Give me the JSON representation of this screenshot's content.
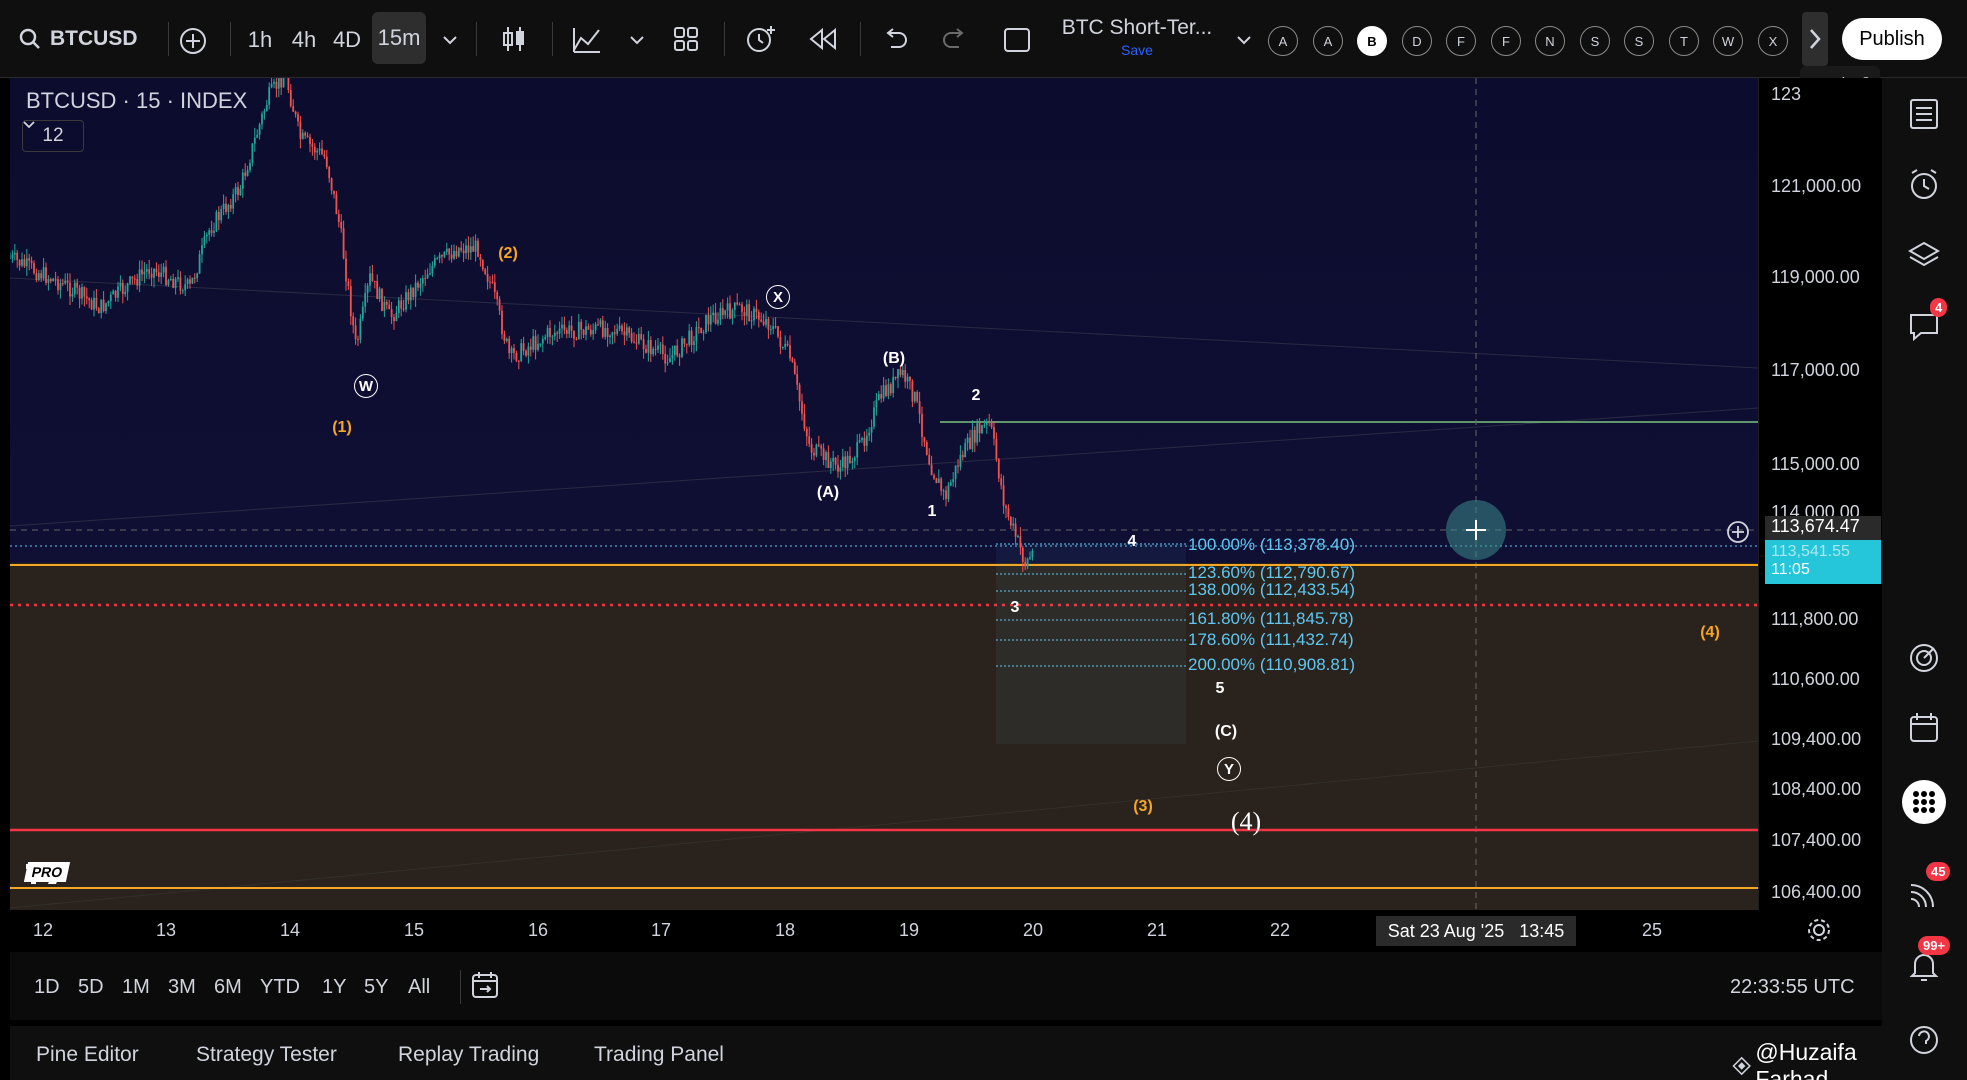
{
  "toolbar": {
    "symbol": "BTCUSD",
    "intervals": [
      "1h",
      "4h",
      "4D",
      "15m"
    ],
    "active_interval": "15m",
    "layout_name": "BTC Short-Ter...",
    "save_label": "Save",
    "letters": [
      "A",
      "A",
      "B",
      "D",
      "F",
      "F",
      "N",
      "S",
      "S",
      "T",
      "W",
      "X"
    ],
    "active_letter": "B",
    "publish_label": "Publish"
  },
  "chart": {
    "legend_title": "BTCUSD · 15 · INDEX",
    "indicator_count": "12",
    "watermark": "PRO",
    "current_price": "113,674.47",
    "countdown": "11:05",
    "last_price_partial": "113,541.55"
  },
  "wave_labels": [
    {
      "text": "W",
      "style": "circle"
    },
    {
      "text": "(1)",
      "style": "orange"
    },
    {
      "text": "(2)",
      "style": "orange"
    },
    {
      "text": "X",
      "style": "circle"
    },
    {
      "text": "(B)",
      "style": "white"
    },
    {
      "text": "(A)",
      "style": "white"
    },
    {
      "text": "2",
      "style": "white"
    },
    {
      "text": "1",
      "style": "white"
    },
    {
      "text": "4",
      "style": "white"
    },
    {
      "text": "3",
      "style": "white"
    },
    {
      "text": "5",
      "style": "white"
    },
    {
      "text": "(C)",
      "style": "white"
    },
    {
      "text": "Y",
      "style": "circle"
    },
    {
      "text": "(3)",
      "style": "orange"
    },
    {
      "text": "(4)",
      "style": "white-large"
    },
    {
      "text": "(4)",
      "style": "orange"
    }
  ],
  "fib_levels": [
    "100.00% (113,378.40)",
    "123.60% (112,790.67)",
    "138.00% (112,433.54)",
    "161.80% (111,845.78)",
    "178.60% (111,432.74)",
    "200.00% (110,908.81)"
  ],
  "price_axis": [
    "123",
    "121,000.00",
    "119,000.00",
    "117,000.00",
    "115,000.00",
    "114,000.00",
    "111,800.00",
    "110,600.00",
    "109,400.00",
    "108,400.00",
    "107,400.00",
    "106,400.00"
  ],
  "time_axis": [
    "12",
    "13",
    "14",
    "15",
    "16",
    "17",
    "18",
    "19",
    "20",
    "21",
    "22",
    "25"
  ],
  "crosshair_time": "Sat 23 Aug '25   13:45",
  "range_buttons": [
    "1D",
    "5D",
    "1M",
    "3M",
    "6M",
    "YTD",
    "1Y",
    "5Y",
    "All"
  ],
  "clock": "22:33:55 UTC",
  "bottom_tabs": [
    "Pine Editor",
    "Strategy Tester",
    "Replay Trading",
    "Trading Panel"
  ],
  "watermark_credit": "@Huzaifa Farhad",
  "sidebar_badges": {
    "alerts": "4",
    "signals": "45",
    "notifications": "99+"
  },
  "colors": {
    "background": "#0c0c2e",
    "orange_line": "#f5a623",
    "red_line": "#f23645",
    "fib": "#5ec8f2",
    "price_tag": "#26c6da",
    "green_line": "#7bc47f"
  }
}
